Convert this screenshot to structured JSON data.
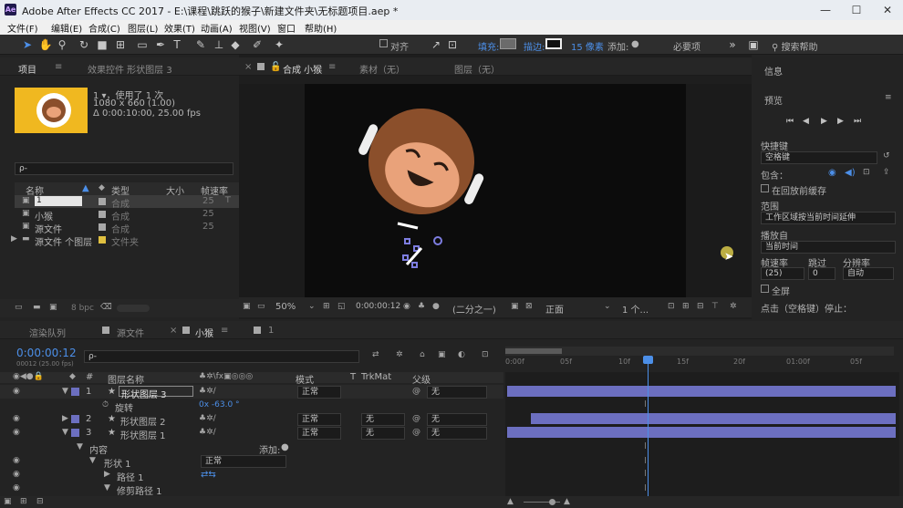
{
  "window": {
    "icon": "Ae",
    "title": "Adobe After Effects CC 2017 - E:\\课程\\跳跃的猴子\\新建文件夹\\无标题项目.aep *"
  },
  "menu": [
    "文件(F)",
    "编辑(E)",
    "合成(C)",
    "图层(L)",
    "效果(T)",
    "动画(A)",
    "视图(V)",
    "窗口",
    "帮助(H)"
  ],
  "toolbar": {
    "align": "对齐",
    "fill": "填充:",
    "stroke": "描边:",
    "stroke_px": "15 像素",
    "add": "添加:",
    "required": "必要项",
    "search_help": "搜索帮助"
  },
  "project": {
    "tab": "项目",
    "effects_tab": "效果控件 形状图层 3",
    "item_name": "1 ▾，使用了 1 次",
    "item_size": "1080 x 660 (1.00)",
    "item_duration": "Δ 0:00:10:00, 25.00 fps",
    "search_placeholder": "ρ-",
    "cols": {
      "name": "名称",
      "type": "类型",
      "size": "大小",
      "fps": "帧速率"
    },
    "rows": [
      {
        "name": "1",
        "type": "合成",
        "fps": "25",
        "color": "#a8a8a8"
      },
      {
        "name": "小猴",
        "type": "合成",
        "fps": "25",
        "color": "#a8a8a8"
      },
      {
        "name": "源文件",
        "type": "合成",
        "fps": "25",
        "color": "#a8a8a8"
      },
      {
        "name": "源文件 个图层",
        "type": "文件夹",
        "fps": "",
        "color": "#e0c040"
      }
    ],
    "bpc": "8 bpc"
  },
  "comp": {
    "tab": "合成 小猴",
    "material": "素材（无）",
    "layer": "图层（无）",
    "zoom": "50%",
    "timecode": "0:00:00:12",
    "resolution": "(二分之一)",
    "view": "正面",
    "views": "1 个..."
  },
  "info": {
    "tab": "信息",
    "preview": "预览",
    "shortcut_label": "快捷键",
    "shortcut": "空格键",
    "include": "包含：",
    "cache": "在回放前缓存",
    "range_label": "范围",
    "range": "工作区域按当前时间延伸",
    "play_from_label": "播放自",
    "play_from": "当前时间",
    "fps_label": "帧速率",
    "skip_label": "跳过",
    "res_label": "分辨率",
    "fps": "(25)",
    "skip": "0",
    "res": "自动",
    "fullscreen": "全屏",
    "click_stop": "点击（空格键）停止："
  },
  "timeline": {
    "tabs": [
      "渲染队列",
      "源文件",
      "小猴",
      "1"
    ],
    "time": "0:00:00:12",
    "frame": "00012 (25.00 fps)",
    "search": "ρ-",
    "cols": {
      "num": "#",
      "name": "图层名称",
      "mode": "模式",
      "t": "T",
      "trkmat": "TrkMat",
      "parent": "父级"
    },
    "ruler": [
      "0:00f",
      "05f",
      "10f",
      "15f",
      "20f",
      "01:00f",
      "05f"
    ],
    "layers": [
      {
        "num": "1",
        "name": "形状图层 3",
        "mode": "正常",
        "trk": "",
        "parent": "无",
        "color": "#6c6fc0"
      },
      {
        "num": "2",
        "name": "形状图层 2",
        "mode": "正常",
        "trk": "无",
        "parent": "无",
        "color": "#6c6fc0"
      },
      {
        "num": "3",
        "name": "形状图层 1",
        "mode": "正常",
        "trk": "无",
        "parent": "无",
        "color": "#6c6fc0"
      }
    ],
    "rotation": {
      "label": "旋转",
      "value": "0x -63.0 °"
    },
    "content": "内容",
    "add": "添加:",
    "shape1": "形状 1",
    "shape_mode": "正常",
    "path1": "路径 1",
    "trim1": "修剪路径 1"
  }
}
